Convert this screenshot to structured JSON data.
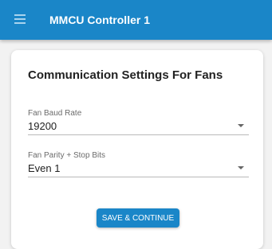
{
  "appbar": {
    "title": "MMCU Controller 1",
    "menu_icon": "hamburger-menu-icon"
  },
  "card": {
    "title": "Communication Settings For Fans",
    "fields": [
      {
        "label": "Fan Baud Rate",
        "value": "19200"
      },
      {
        "label": "Fan Parity + Stop Bits",
        "value": "Even 1"
      }
    ],
    "save_label": "SAVE & CONTINUE"
  },
  "colors": {
    "primary": "#1a86c8",
    "background": "#f2f2f2"
  }
}
